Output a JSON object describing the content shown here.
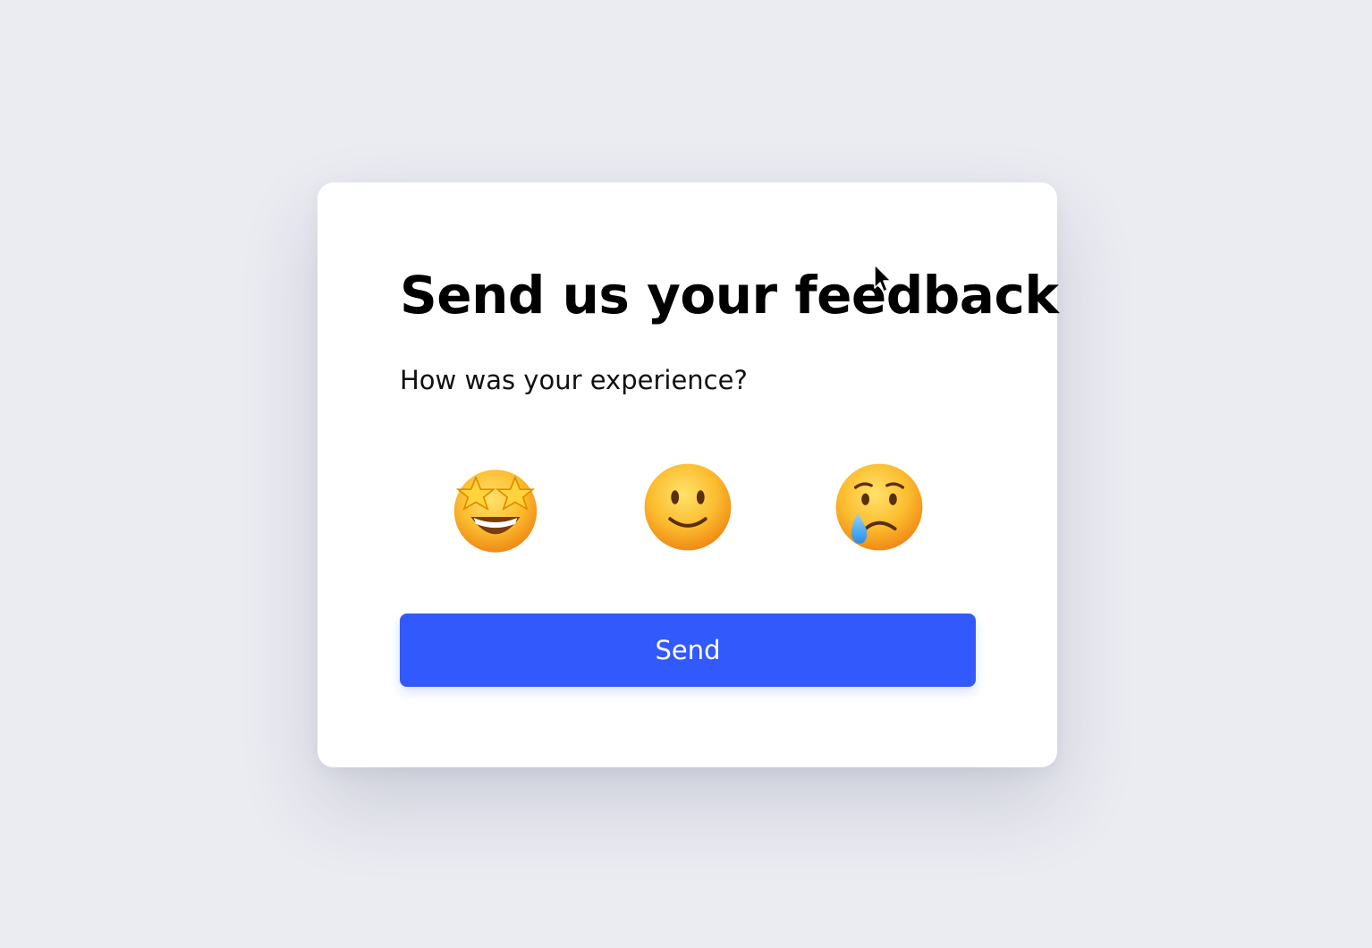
{
  "feedback_card": {
    "title": "Send us your feedback",
    "question": "How was your experience?",
    "ratings": [
      {
        "icon": "star-struck-emoji-icon"
      },
      {
        "icon": "slightly-smiling-emoji-icon"
      },
      {
        "icon": "crying-emoji-icon"
      }
    ],
    "send_label": "Send"
  },
  "colors": {
    "background": "#ebecf2",
    "card": "#ffffff",
    "button": "#3159fb",
    "button_text": "#ffffff",
    "emoji_face": "#fbbf24"
  }
}
